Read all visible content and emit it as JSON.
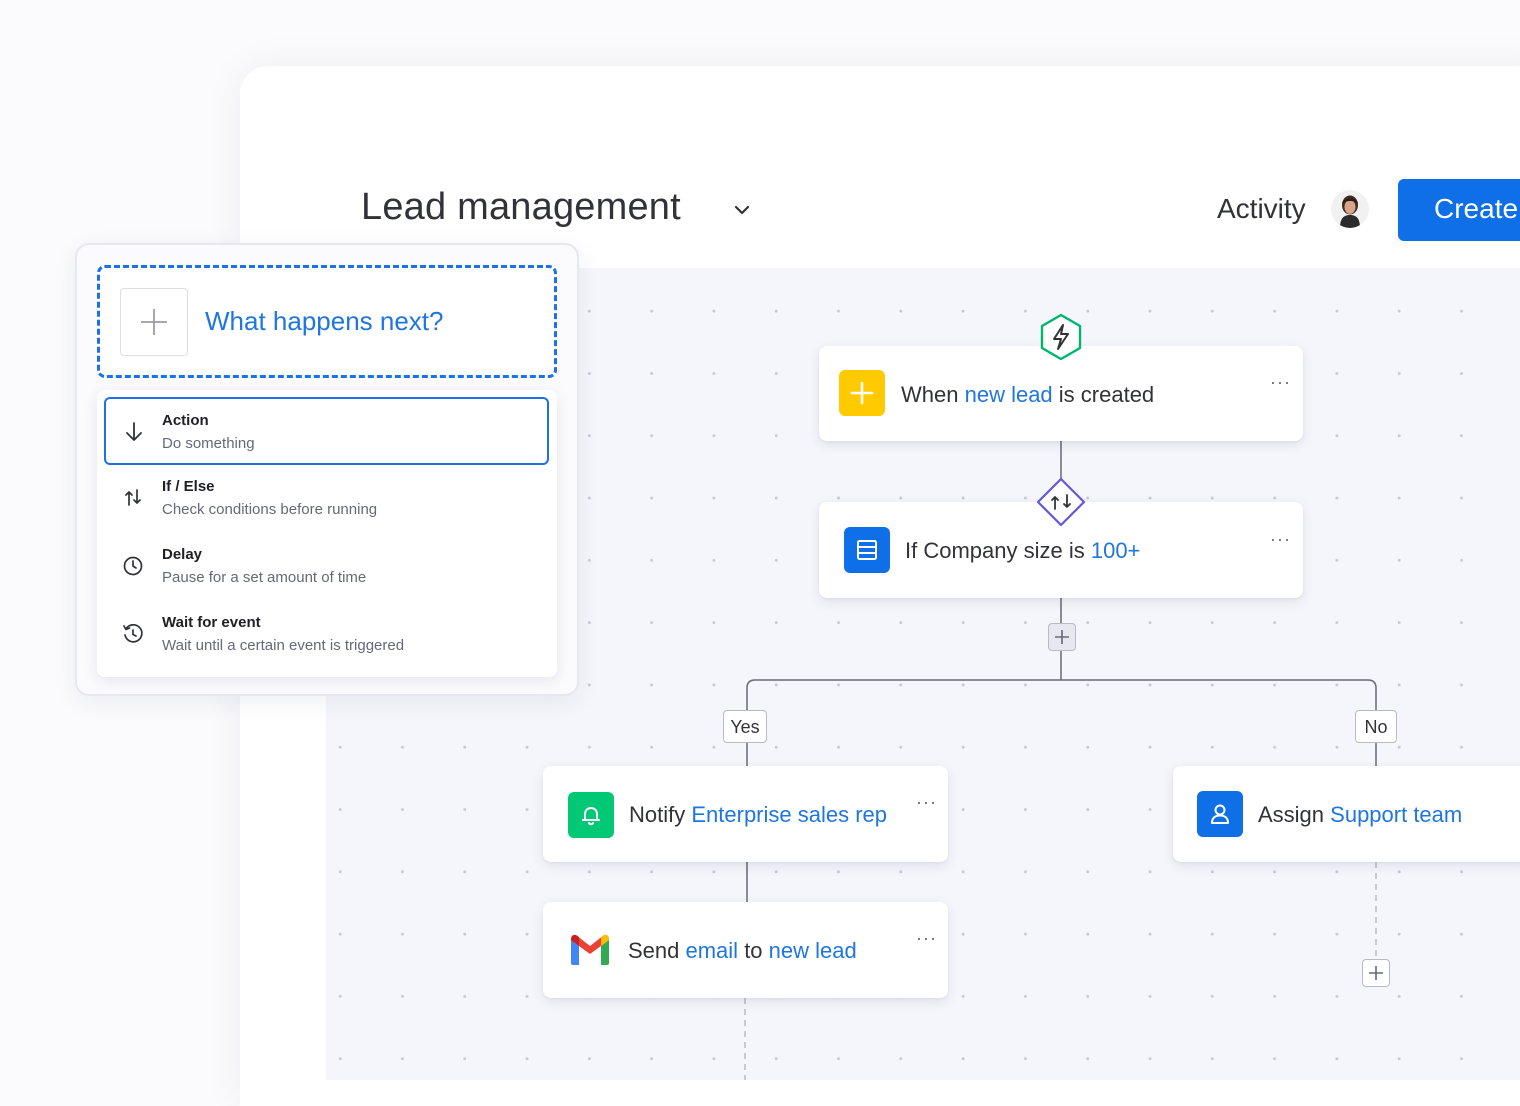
{
  "header": {
    "title": "Lead management",
    "activity_label": "Activity",
    "create_label": "Create"
  },
  "panel": {
    "next_label": "What happens next?",
    "items": [
      {
        "title": "Action",
        "subtitle": "Do something",
        "icon": "arrow-down-icon"
      },
      {
        "title": "If / Else",
        "subtitle": "Check conditions before running",
        "icon": "branch-icon"
      },
      {
        "title": "Delay",
        "subtitle": "Pause for a set amount of time",
        "icon": "clock-icon"
      },
      {
        "title": "Wait for event",
        "subtitle": "Wait until a certain event is triggered",
        "icon": "history-clock-icon"
      }
    ]
  },
  "flow": {
    "trigger": {
      "pre": "When ",
      "highlight": "new lead",
      "post": " is created",
      "icon": "plus-icon"
    },
    "condition": {
      "pre": "If Company size is ",
      "highlight": "100+",
      "icon": "table-icon"
    },
    "yes_label": "Yes",
    "no_label": "No",
    "notify": {
      "pre": "Notify ",
      "highlight": "Enterprise sales rep",
      "icon": "bell-icon"
    },
    "assign": {
      "pre": "Assign ",
      "highlight": "Support team",
      "icon": "person-icon"
    },
    "email": {
      "pre": "Send ",
      "highlight1": "email",
      "mid": " to ",
      "highlight2": "new lead",
      "icon": "gmail-icon"
    },
    "more_label": "···"
  },
  "colors": {
    "accent": "#1f76e0",
    "create_button": "#0f6fe6",
    "trigger_icon": "#ffcb00",
    "condition_icon": "#0f6fe6",
    "notify_icon": "#00c875",
    "assign_icon": "#0f6fe6",
    "trigger_badge": "#00b66e",
    "condition_badge": "#6457d9"
  }
}
